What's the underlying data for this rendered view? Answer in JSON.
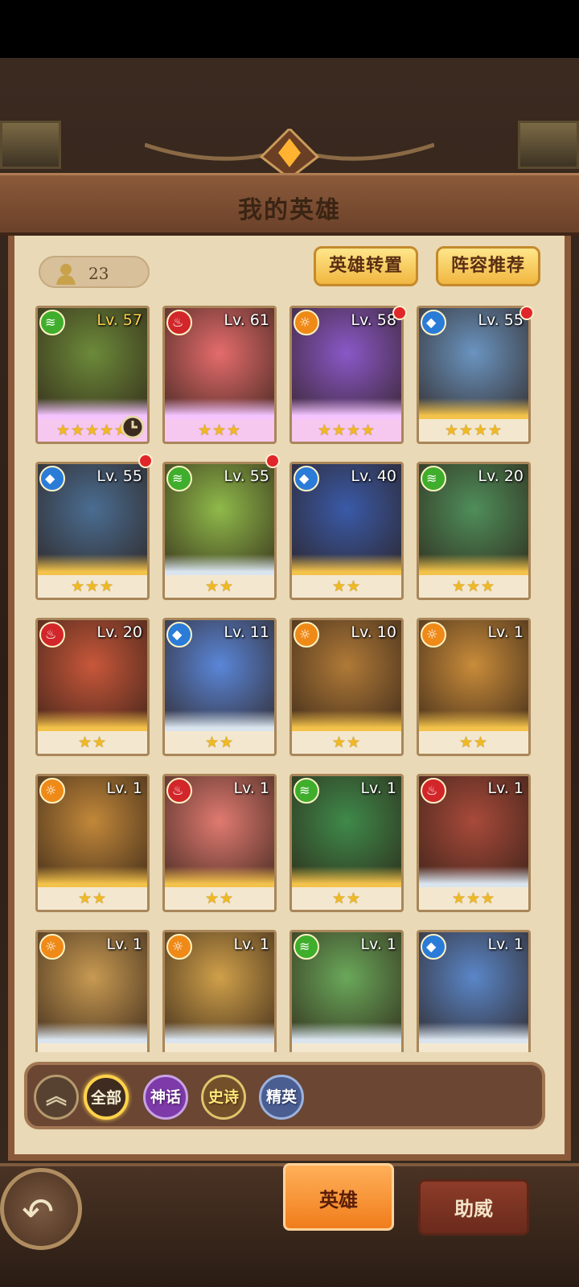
{
  "screen": {
    "title": "我的英雄",
    "hero_count": "23",
    "buttons": {
      "transfer": "英雄转置",
      "lineup": "阵容推荐"
    }
  },
  "filters": {
    "all": "全部",
    "myth": "神话",
    "epic": "史诗",
    "elite": "精英",
    "active": "all"
  },
  "tabs": {
    "heroes": "英雄",
    "support": "助威",
    "active": "heroes"
  },
  "heroes": [
    {
      "level": "Lv. 57",
      "element": "wind",
      "stars": 5,
      "rarity": "myth",
      "bg": "#6c8a3a",
      "red_dot": false,
      "clock": true
    },
    {
      "level": "Lv. 61",
      "element": "fire",
      "stars": 3,
      "rarity": "myth",
      "bg": "#e46c6c",
      "red_dot": false
    },
    {
      "level": "Lv. 58",
      "element": "light",
      "stars": 4,
      "rarity": "myth",
      "bg": "#8a58c8",
      "red_dot": true
    },
    {
      "level": "Lv. 55",
      "element": "water",
      "stars": 4,
      "rarity": "epic",
      "bg": "#6a94c0",
      "red_dot": true
    },
    {
      "level": "Lv. 55",
      "element": "water",
      "stars": 3,
      "rarity": "epic",
      "bg": "#4a6d92",
      "red_dot": true
    },
    {
      "level": "Lv. 55",
      "element": "wind",
      "stars": 2,
      "rarity": "elite",
      "bg": "#8fba4a",
      "red_dot": true
    },
    {
      "level": "Lv. 40",
      "element": "water",
      "stars": 2,
      "rarity": "epic",
      "bg": "#3a5aa8",
      "red_dot": false
    },
    {
      "level": "Lv. 20",
      "element": "wind",
      "stars": 3,
      "rarity": "epic",
      "bg": "#4f8e5a",
      "red_dot": false
    },
    {
      "level": "Lv. 20",
      "element": "fire",
      "stars": 2,
      "rarity": "epic",
      "bg": "#c8573a",
      "red_dot": false
    },
    {
      "level": "Lv. 11",
      "element": "water",
      "stars": 2,
      "rarity": "elite",
      "bg": "#5a86d8",
      "red_dot": false
    },
    {
      "level": "Lv. 10",
      "element": "light",
      "stars": 2,
      "rarity": "epic",
      "bg": "#b07a38",
      "red_dot": false
    },
    {
      "level": "Lv. 1",
      "element": "light",
      "stars": 2,
      "rarity": "epic",
      "bg": "#c98c3a",
      "red_dot": false
    },
    {
      "level": "Lv. 1",
      "element": "light",
      "stars": 2,
      "rarity": "epic",
      "bg": "#c2883a",
      "red_dot": false
    },
    {
      "level": "Lv. 1",
      "element": "fire",
      "stars": 2,
      "rarity": "epic",
      "bg": "#e07a70",
      "red_dot": false
    },
    {
      "level": "Lv. 1",
      "element": "wind",
      "stars": 2,
      "rarity": "epic",
      "bg": "#3f8a4a",
      "red_dot": false
    },
    {
      "level": "Lv. 1",
      "element": "fire",
      "stars": 3,
      "rarity": "elite",
      "bg": "#a84a3a",
      "red_dot": false
    },
    {
      "level": "Lv. 1",
      "element": "light",
      "stars": 0,
      "rarity": "elite",
      "bg": "#c89a52",
      "red_dot": false
    },
    {
      "level": "Lv. 1",
      "element": "light",
      "stars": 0,
      "rarity": "elite",
      "bg": "#d0a04a",
      "red_dot": false
    },
    {
      "level": "Lv. 1",
      "element": "wind",
      "stars": 0,
      "rarity": "elite",
      "bg": "#6aa85a",
      "red_dot": false
    },
    {
      "level": "Lv. 1",
      "element": "water",
      "stars": 0,
      "rarity": "elite",
      "bg": "#5a86c8",
      "red_dot": false
    }
  ],
  "element_colors": {
    "wind": "#3fae2c",
    "fire": "#d2262a",
    "light": "#ef8a18",
    "water": "#2a7cd8"
  }
}
